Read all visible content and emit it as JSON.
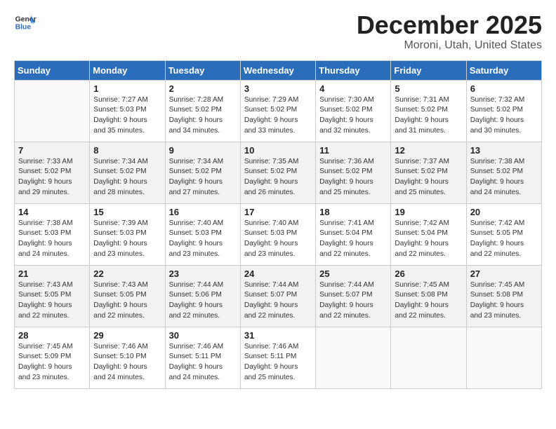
{
  "logo": {
    "line1": "General",
    "line2": "Blue"
  },
  "header": {
    "month": "December 2025",
    "location": "Moroni, Utah, United States"
  },
  "weekdays": [
    "Sunday",
    "Monday",
    "Tuesday",
    "Wednesday",
    "Thursday",
    "Friday",
    "Saturday"
  ],
  "weeks": [
    [
      {
        "day": "",
        "info": ""
      },
      {
        "day": "1",
        "info": "Sunrise: 7:27 AM\nSunset: 5:03 PM\nDaylight: 9 hours\nand 35 minutes."
      },
      {
        "day": "2",
        "info": "Sunrise: 7:28 AM\nSunset: 5:02 PM\nDaylight: 9 hours\nand 34 minutes."
      },
      {
        "day": "3",
        "info": "Sunrise: 7:29 AM\nSunset: 5:02 PM\nDaylight: 9 hours\nand 33 minutes."
      },
      {
        "day": "4",
        "info": "Sunrise: 7:30 AM\nSunset: 5:02 PM\nDaylight: 9 hours\nand 32 minutes."
      },
      {
        "day": "5",
        "info": "Sunrise: 7:31 AM\nSunset: 5:02 PM\nDaylight: 9 hours\nand 31 minutes."
      },
      {
        "day": "6",
        "info": "Sunrise: 7:32 AM\nSunset: 5:02 PM\nDaylight: 9 hours\nand 30 minutes."
      }
    ],
    [
      {
        "day": "7",
        "info": "Sunrise: 7:33 AM\nSunset: 5:02 PM\nDaylight: 9 hours\nand 29 minutes."
      },
      {
        "day": "8",
        "info": "Sunrise: 7:34 AM\nSunset: 5:02 PM\nDaylight: 9 hours\nand 28 minutes."
      },
      {
        "day": "9",
        "info": "Sunrise: 7:34 AM\nSunset: 5:02 PM\nDaylight: 9 hours\nand 27 minutes."
      },
      {
        "day": "10",
        "info": "Sunrise: 7:35 AM\nSunset: 5:02 PM\nDaylight: 9 hours\nand 26 minutes."
      },
      {
        "day": "11",
        "info": "Sunrise: 7:36 AM\nSunset: 5:02 PM\nDaylight: 9 hours\nand 25 minutes."
      },
      {
        "day": "12",
        "info": "Sunrise: 7:37 AM\nSunset: 5:02 PM\nDaylight: 9 hours\nand 25 minutes."
      },
      {
        "day": "13",
        "info": "Sunrise: 7:38 AM\nSunset: 5:02 PM\nDaylight: 9 hours\nand 24 minutes."
      }
    ],
    [
      {
        "day": "14",
        "info": "Sunrise: 7:38 AM\nSunset: 5:03 PM\nDaylight: 9 hours\nand 24 minutes."
      },
      {
        "day": "15",
        "info": "Sunrise: 7:39 AM\nSunset: 5:03 PM\nDaylight: 9 hours\nand 23 minutes."
      },
      {
        "day": "16",
        "info": "Sunrise: 7:40 AM\nSunset: 5:03 PM\nDaylight: 9 hours\nand 23 minutes."
      },
      {
        "day": "17",
        "info": "Sunrise: 7:40 AM\nSunset: 5:03 PM\nDaylight: 9 hours\nand 23 minutes."
      },
      {
        "day": "18",
        "info": "Sunrise: 7:41 AM\nSunset: 5:04 PM\nDaylight: 9 hours\nand 22 minutes."
      },
      {
        "day": "19",
        "info": "Sunrise: 7:42 AM\nSunset: 5:04 PM\nDaylight: 9 hours\nand 22 minutes."
      },
      {
        "day": "20",
        "info": "Sunrise: 7:42 AM\nSunset: 5:05 PM\nDaylight: 9 hours\nand 22 minutes."
      }
    ],
    [
      {
        "day": "21",
        "info": "Sunrise: 7:43 AM\nSunset: 5:05 PM\nDaylight: 9 hours\nand 22 minutes."
      },
      {
        "day": "22",
        "info": "Sunrise: 7:43 AM\nSunset: 5:05 PM\nDaylight: 9 hours\nand 22 minutes."
      },
      {
        "day": "23",
        "info": "Sunrise: 7:44 AM\nSunset: 5:06 PM\nDaylight: 9 hours\nand 22 minutes."
      },
      {
        "day": "24",
        "info": "Sunrise: 7:44 AM\nSunset: 5:07 PM\nDaylight: 9 hours\nand 22 minutes."
      },
      {
        "day": "25",
        "info": "Sunrise: 7:44 AM\nSunset: 5:07 PM\nDaylight: 9 hours\nand 22 minutes."
      },
      {
        "day": "26",
        "info": "Sunrise: 7:45 AM\nSunset: 5:08 PM\nDaylight: 9 hours\nand 22 minutes."
      },
      {
        "day": "27",
        "info": "Sunrise: 7:45 AM\nSunset: 5:08 PM\nDaylight: 9 hours\nand 23 minutes."
      }
    ],
    [
      {
        "day": "28",
        "info": "Sunrise: 7:45 AM\nSunset: 5:09 PM\nDaylight: 9 hours\nand 23 minutes."
      },
      {
        "day": "29",
        "info": "Sunrise: 7:46 AM\nSunset: 5:10 PM\nDaylight: 9 hours\nand 24 minutes."
      },
      {
        "day": "30",
        "info": "Sunrise: 7:46 AM\nSunset: 5:11 PM\nDaylight: 9 hours\nand 24 minutes."
      },
      {
        "day": "31",
        "info": "Sunrise: 7:46 AM\nSunset: 5:11 PM\nDaylight: 9 hours\nand 25 minutes."
      },
      {
        "day": "",
        "info": ""
      },
      {
        "day": "",
        "info": ""
      },
      {
        "day": "",
        "info": ""
      }
    ]
  ]
}
